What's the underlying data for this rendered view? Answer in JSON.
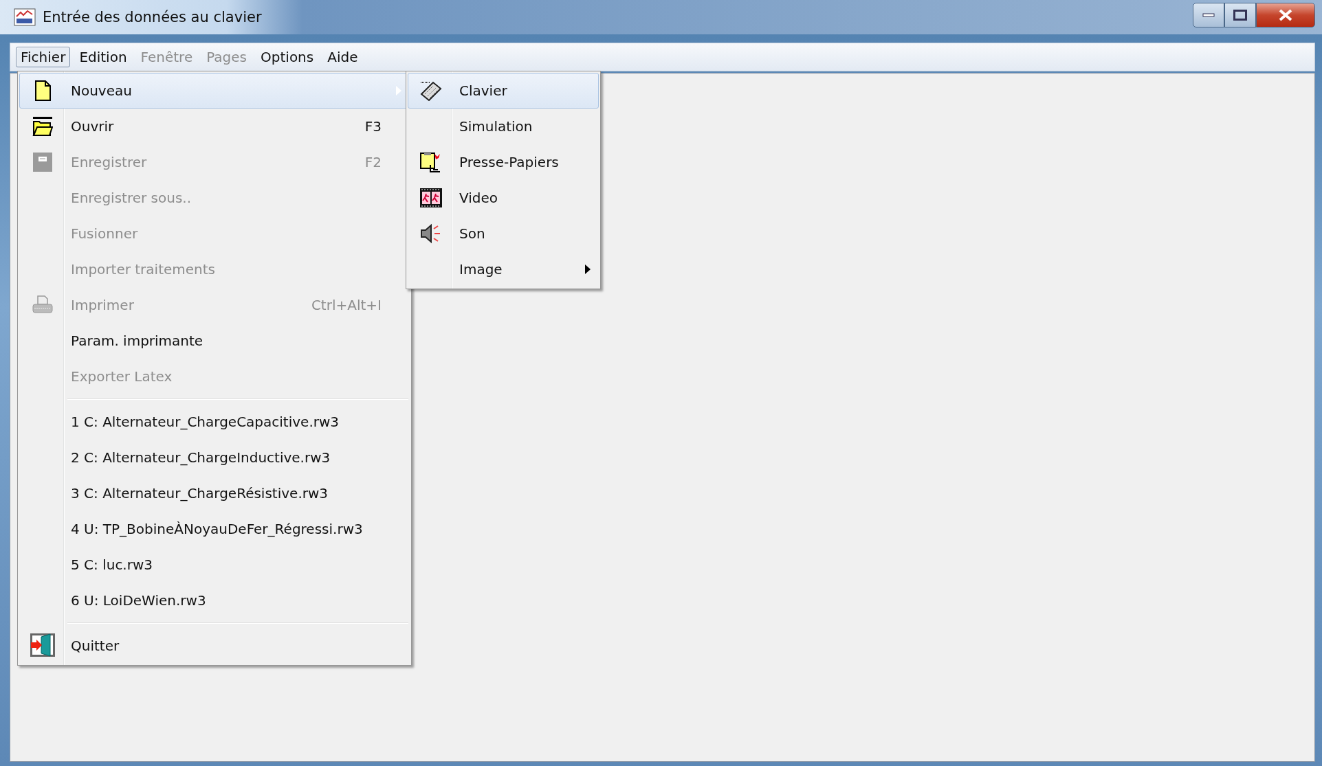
{
  "window": {
    "title": "Entrée des données au clavier"
  },
  "menubar": [
    {
      "label": "Fichier",
      "selected": true,
      "disabled": false
    },
    {
      "label": "Edition",
      "selected": false,
      "disabled": false
    },
    {
      "label": "Fenêtre",
      "selected": false,
      "disabled": true
    },
    {
      "label": "Pages",
      "selected": false,
      "disabled": true
    },
    {
      "label": "Options",
      "selected": false,
      "disabled": false
    },
    {
      "label": "Aide",
      "selected": false,
      "disabled": false
    }
  ],
  "file_menu": [
    {
      "kind": "item",
      "label": "Nouveau",
      "submenu": true,
      "selected": true,
      "disabled": false
    },
    {
      "kind": "item",
      "label": "Ouvrir",
      "shortcut": "F3",
      "selected": false,
      "disabled": false
    },
    {
      "kind": "item",
      "label": "Enregistrer",
      "shortcut": "F2",
      "selected": false,
      "disabled": true
    },
    {
      "kind": "item",
      "label": "Enregistrer sous..",
      "selected": false,
      "disabled": true
    },
    {
      "kind": "item",
      "label": "Fusionner",
      "selected": false,
      "disabled": true
    },
    {
      "kind": "item",
      "label": "Importer traitements",
      "selected": false,
      "disabled": true
    },
    {
      "kind": "item",
      "label": "Imprimer",
      "shortcut": "Ctrl+Alt+I",
      "selected": false,
      "disabled": true
    },
    {
      "kind": "item",
      "label": "Param. imprimante",
      "selected": false,
      "disabled": false
    },
    {
      "kind": "item",
      "label": "Exporter Latex",
      "selected": false,
      "disabled": true
    },
    {
      "kind": "separator"
    },
    {
      "kind": "item",
      "label": "1 C: Alternateur_ChargeCapacitive.rw3",
      "selected": false,
      "disabled": false
    },
    {
      "kind": "item",
      "label": "2 C: Alternateur_ChargeInductive.rw3",
      "selected": false,
      "disabled": false
    },
    {
      "kind": "item",
      "label": "3 C: Alternateur_ChargeRésistive.rw3",
      "selected": false,
      "disabled": false
    },
    {
      "kind": "item",
      "label": "4 U: TP_BobineÀNoyauDeFer_Régressi.rw3",
      "selected": false,
      "disabled": false
    },
    {
      "kind": "item",
      "label": "5 C: luc.rw3",
      "selected": false,
      "disabled": false
    },
    {
      "kind": "item",
      "label": "6 U: LoiDeWien.rw3",
      "selected": false,
      "disabled": false
    },
    {
      "kind": "separator"
    },
    {
      "kind": "item",
      "label": "Quitter",
      "selected": false,
      "disabled": false
    }
  ],
  "new_submenu": [
    {
      "kind": "item",
      "label": "Clavier",
      "selected": true,
      "disabled": false
    },
    {
      "kind": "item",
      "label": "Simulation",
      "selected": false,
      "disabled": false
    },
    {
      "kind": "item",
      "label": "Presse-Papiers",
      "selected": false,
      "disabled": false
    },
    {
      "kind": "item",
      "label": "Video",
      "selected": false,
      "disabled": false
    },
    {
      "kind": "item",
      "label": "Son",
      "selected": false,
      "disabled": false
    },
    {
      "kind": "item",
      "label": "Image",
      "submenu": true,
      "selected": false,
      "disabled": false
    }
  ]
}
